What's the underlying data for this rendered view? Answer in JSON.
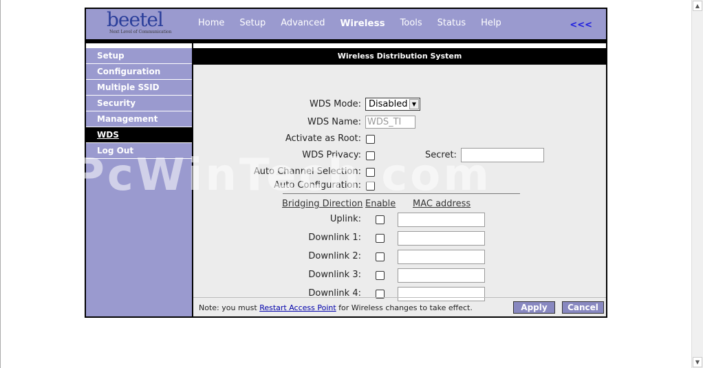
{
  "header": {
    "logo_text": "beetel",
    "logo_tagline": "Next Level of Communication",
    "nav": [
      {
        "label": "Home",
        "active": false
      },
      {
        "label": "Setup",
        "active": false
      },
      {
        "label": "Advanced",
        "active": false
      },
      {
        "label": "Wireless",
        "active": true
      },
      {
        "label": "Tools",
        "active": false
      },
      {
        "label": "Status",
        "active": false
      },
      {
        "label": "Help",
        "active": false
      }
    ],
    "collapse": "<<<"
  },
  "sidebar": {
    "items": [
      {
        "label": "Setup"
      },
      {
        "label": "Configuration"
      },
      {
        "label": "Multiple SSID"
      },
      {
        "label": "Security"
      },
      {
        "label": "Management"
      },
      {
        "label": "WDS",
        "active": true
      },
      {
        "label": "Log Out"
      }
    ]
  },
  "content": {
    "title": "Wireless Distribution System",
    "wds_mode_label": "WDS Mode:",
    "wds_mode_value": "Disabled",
    "wds_name_label": "WDS Name:",
    "wds_name_value": "WDS_TI",
    "activate_root_label": "Activate as Root:",
    "wds_privacy_label": "WDS Privacy:",
    "secret_label": "Secret:",
    "secret_value": "",
    "auto_channel_label": "Auto Channel Selection:",
    "auto_config_label": "Auto Configuration:",
    "table_headers": {
      "direction": "Bridging Direction",
      "enable": "Enable",
      "mac": "MAC address"
    },
    "links": [
      {
        "label": "Uplink:",
        "mac": ""
      },
      {
        "label": "Downlink 1:",
        "mac": ""
      },
      {
        "label": "Downlink 2:",
        "mac": ""
      },
      {
        "label": "Downlink 3:",
        "mac": ""
      },
      {
        "label": "Downlink 4:",
        "mac": ""
      }
    ]
  },
  "footer": {
    "note_prefix": "Note: you must ",
    "note_link": "Restart Access Point",
    "note_suffix": " for Wireless changes to take effect.",
    "apply": "Apply",
    "cancel": "Cancel"
  },
  "watermark": "PcWinTech.com",
  "colors": {
    "header_bg": "#9a9acf",
    "content_bg": "#ececec",
    "link": "#1a1ae0"
  }
}
